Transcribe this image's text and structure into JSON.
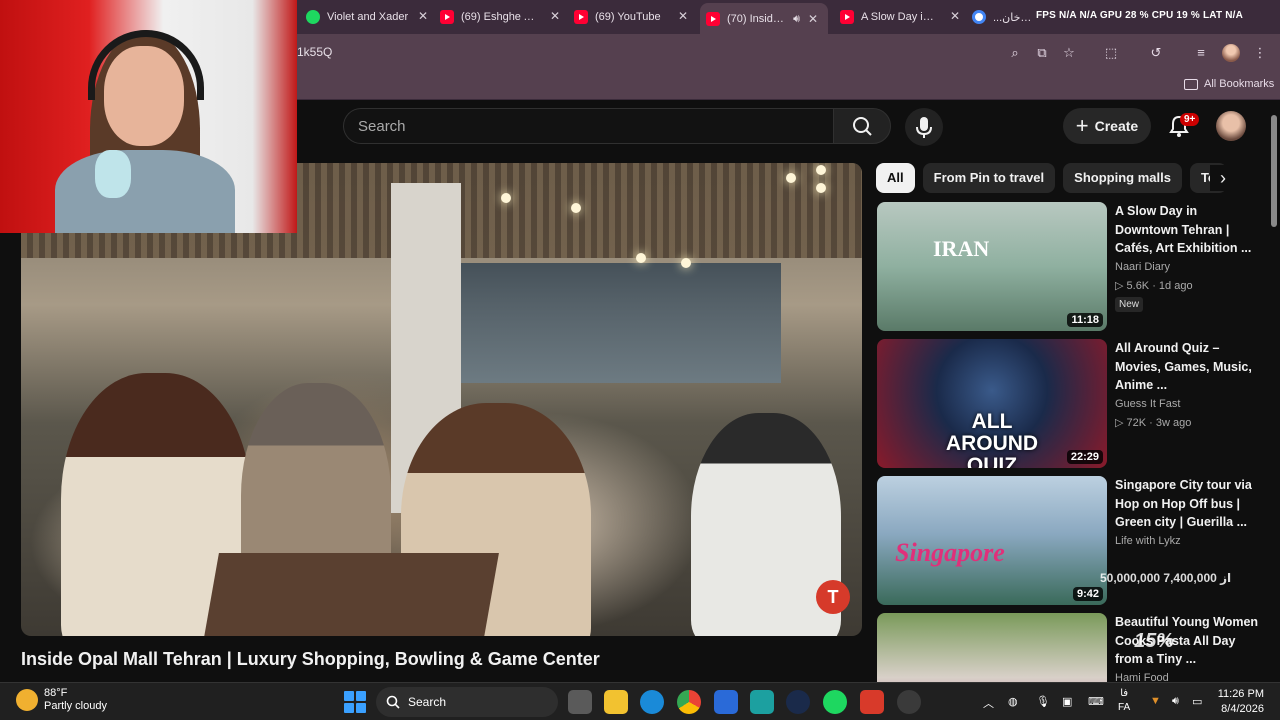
{
  "browser": {
    "tabs": [
      {
        "title": "Violet and Xader",
        "icon": "spotify-icon"
      },
      {
        "title": "(69) Eshghe Abad",
        "icon": "youtube-icon"
      },
      {
        "title": "(69) YouTube",
        "icon": "youtube-icon"
      },
      {
        "title": "(70) Inside O",
        "icon": "youtube-icon",
        "active": true
      },
      {
        "title": "A Slow Day in Do",
        "icon": "youtube-icon"
      },
      {
        "title": "...حسن خان",
        "icon": "google-icon"
      }
    ],
    "system_stats": "FPS N/A N/A  GPU 28 %  CPU 19 %  LAT N/A",
    "url_fragment": "1k55Q",
    "bookmarks_label": "All Bookmarks"
  },
  "youtube": {
    "search_placeholder": "Search",
    "create_label": "Create",
    "notification_count": "9+",
    "video_title": "Inside Opal Mall Tehran | Luxury Shopping, Bowling & Game Center",
    "chips": [
      "All",
      "From Pin to travel",
      "Shopping malls",
      "To"
    ],
    "recommendations": [
      {
        "title": "A Slow Day in Downtown Tehran | Cafés, Art Exhibition ...",
        "channel": "Naari Diary",
        "meta": "5.6K · 1d ago",
        "badge": "New",
        "duration": "11:18",
        "thumb_text": "IRAN"
      },
      {
        "title": "All Around Quiz – Movies, Games, Music, Anime ...",
        "channel": "Guess It Fast",
        "meta": "72K · 3w ago",
        "duration": "22:29",
        "thumb_text": "ALL AROUND QUIZ"
      },
      {
        "title": "Singapore City tour via Hop on Hop Off bus | Green city | Guerilla ...",
        "channel": "Life with Lykz",
        "meta": "",
        "duration": "9:42",
        "thumb_text": "Singapore"
      },
      {
        "title": "Beautiful Young Women Cooks Pasta All Day from a Tiny ...",
        "channel": "Hami Food",
        "meta": "",
        "duration": ""
      }
    ],
    "overlay_donation": "50,000,000 از 7,400,000",
    "overlay_percent": "15%"
  },
  "taskbar": {
    "weather_temp": "88°F",
    "weather_desc": "Partly cloudy",
    "search_label": "Search",
    "lang_top": "فا",
    "lang_bottom": "FA",
    "time": "11:26 PM",
    "date": "8/4/2026"
  },
  "colors": {
    "youtube_red": "#ff0033",
    "accent_blue": "#3aa0ff",
    "badge_red": "#cc0000"
  }
}
